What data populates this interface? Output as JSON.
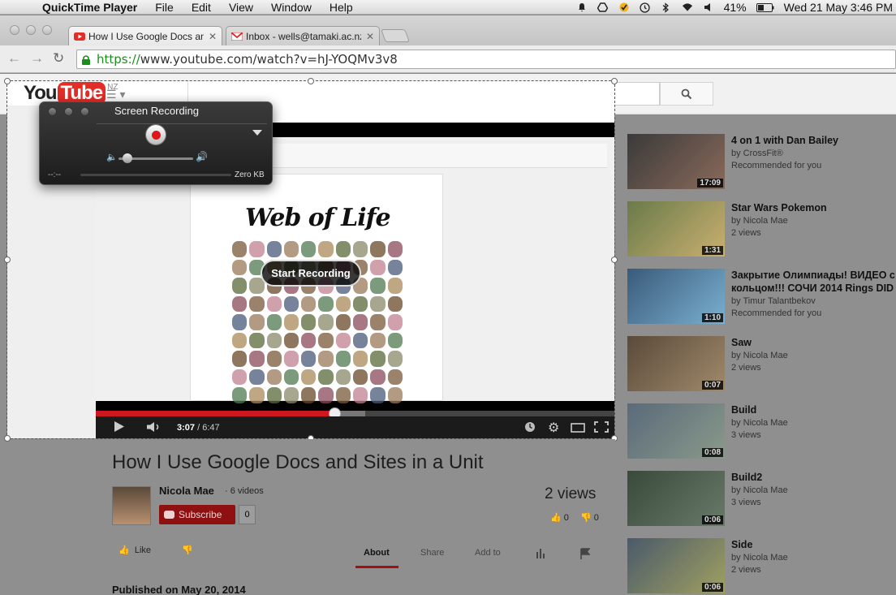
{
  "menubar": {
    "app_name": "QuickTime Player",
    "menus": [
      "File",
      "Edit",
      "View",
      "Window",
      "Help"
    ],
    "battery": "41%",
    "clock": "Wed 21 May  3:46 PM"
  },
  "browser": {
    "tabs": [
      {
        "title": "How I Use Google Docs and Sites in a Unit",
        "favicon": "youtube-icon"
      },
      {
        "title": "Inbox - wells@tamaki.ac.nz",
        "favicon": "gmail-icon"
      }
    ],
    "url_scheme": "https://",
    "url_rest": "www.youtube.com/watch?v=hJ-YOQMv3v8"
  },
  "youtube": {
    "logo_you": "You",
    "logo_tube": "Tube",
    "region": "NZ"
  },
  "screen_recording": {
    "title": "Screen Recording",
    "time": "--:--",
    "size": "Zero KB",
    "volume_level": 0.05
  },
  "video": {
    "doc_title": "Web of Life",
    "start_recording_label": "Start Recording",
    "current_time": "3:07",
    "duration": "6:47",
    "played_fraction": 0.46,
    "loaded_fraction": 0.52
  },
  "watch": {
    "title": "How I Use Google Docs and Sites in a Unit",
    "channel": "Nicola Mae",
    "video_count": "6 videos",
    "subscribe_label": "Subscribe",
    "subscriber_count": "0",
    "views": "2 views",
    "likes": "0",
    "dislikes": "0",
    "like_label": "Like",
    "action_tabs": [
      "About",
      "Share",
      "Add to"
    ],
    "published": "Published on May 20, 2014"
  },
  "related": [
    {
      "title": "4 on 1 with Dan Bailey",
      "by": "by CrossFit®",
      "meta": "Recommended for you",
      "duration": "17:09",
      "colors": [
        "#3a3a3a",
        "#8a6a5a"
      ]
    },
    {
      "title": "Star Wars Pokemon",
      "by": "by Nicola Mae",
      "meta": "2 views",
      "duration": "1:31",
      "colors": [
        "#6a7a4a",
        "#c9b070"
      ]
    },
    {
      "title": "Закрытие Олимпиады! ВИДЕО с кольцом!!! СОЧИ 2014 Rings DID",
      "by": "by Timur Talantbekov",
      "meta": "Recommended for you",
      "duration": "1:10",
      "colors": [
        "#3a5a7a",
        "#7ab0d0"
      ]
    },
    {
      "title": "Saw",
      "by": "by Nicola Mae",
      "meta": "2 views",
      "duration": "0:07",
      "colors": [
        "#5a4a3a",
        "#a08a6a"
      ]
    },
    {
      "title": "Build",
      "by": "by Nicola Mae",
      "meta": "3 views",
      "duration": "0:08",
      "colors": [
        "#5a6a7a",
        "#8a9a8a"
      ]
    },
    {
      "title": "Build2",
      "by": "by Nicola Mae",
      "meta": "3 views",
      "duration": "0:06",
      "colors": [
        "#3a4a3a",
        "#6a7a6a"
      ]
    },
    {
      "title": "Side",
      "by": "by Nicola Mae",
      "meta": "2 views",
      "duration": "0:06",
      "colors": [
        "#4a5a6a",
        "#a0a060"
      ]
    }
  ]
}
